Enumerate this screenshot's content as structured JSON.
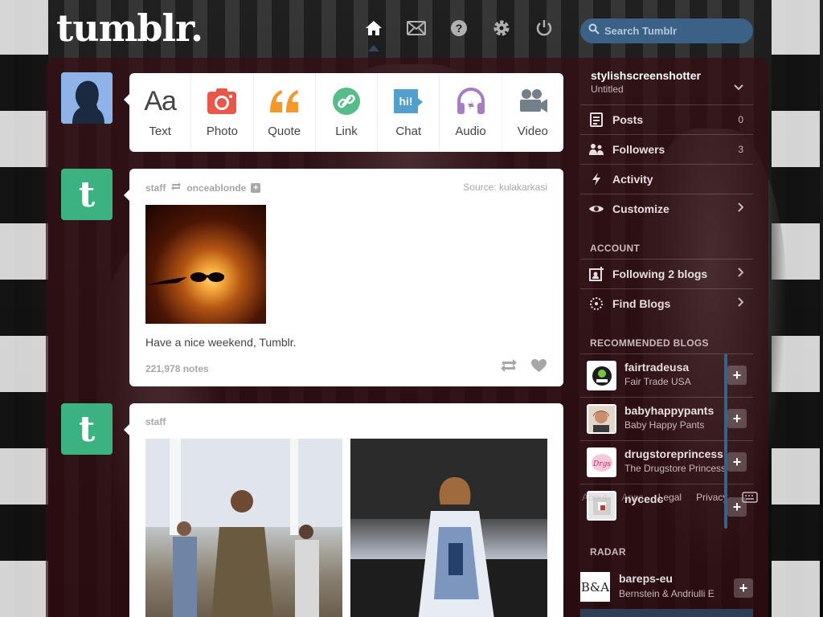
{
  "header": {
    "logo": "tumblr.",
    "nav": [
      {
        "icon": "home-icon",
        "active": true
      },
      {
        "icon": "mail-icon",
        "active": false
      },
      {
        "icon": "help-icon",
        "active": false
      },
      {
        "icon": "gear-icon",
        "active": false
      },
      {
        "icon": "power-icon",
        "active": false
      }
    ],
    "search_placeholder": "Search Tumblr"
  },
  "post_types": [
    {
      "label": "Text",
      "icon": "text-icon",
      "color": "#444444"
    },
    {
      "label": "Photo",
      "icon": "camera-icon",
      "color": "#e8574a"
    },
    {
      "label": "Quote",
      "icon": "quote-icon",
      "color": "#f2992e"
    },
    {
      "label": "Link",
      "icon": "link-icon",
      "color": "#56bc8a"
    },
    {
      "label": "Chat",
      "icon": "chat-icon",
      "color": "#529ecc"
    },
    {
      "label": "Audio",
      "icon": "headphones-icon",
      "color": "#a77dc2"
    },
    {
      "label": "Video",
      "icon": "video-camera-icon",
      "color": "#748089"
    }
  ],
  "posts": [
    {
      "author": "staff",
      "reblogged_from": "onceablonde",
      "source_label": "Source:",
      "source": "kulakarkasi",
      "caption": "Have a nice weekend, Tumblr.",
      "notes": "221,978 notes"
    },
    {
      "author": "staff"
    }
  ],
  "sidebar": {
    "blog_name": "stylishscreenshotter",
    "blog_title": "Untitled",
    "items": [
      {
        "label": "Posts",
        "icon": "posts-icon",
        "count": "0"
      },
      {
        "label": "Followers",
        "icon": "followers-icon",
        "count": "3"
      },
      {
        "label": "Activity",
        "icon": "activity-icon",
        "count": ""
      },
      {
        "label": "Customize",
        "icon": "eye-icon",
        "count": ""
      }
    ],
    "account_heading": "ACCOUNT",
    "account_items": [
      {
        "label": "Following 2 blogs",
        "icon": "following-icon"
      },
      {
        "label": "Find Blogs",
        "icon": "find-blogs-icon"
      }
    ],
    "recommended_heading": "RECOMMENDED BLOGS",
    "recommended": [
      {
        "name": "fairtradeusa",
        "desc": "Fair Trade USA",
        "thumb_color": "#ffffff"
      },
      {
        "name": "babyhappypants",
        "desc": "Baby Happy Pants",
        "thumb_color": "#c9a48a"
      },
      {
        "name": "drugstoreprincess",
        "desc": "The Drugstore Princess",
        "thumb_color": "#f4c9d9"
      },
      {
        "name": "nycedc",
        "desc": "",
        "thumb_color": "#e6e6e6"
      }
    ],
    "footer_links": [
      "About",
      "Apps",
      "Legal",
      "Privacy"
    ],
    "radar_heading": "RADAR",
    "radar": {
      "name": "bareps-eu",
      "desc": "Bernstein & Andriulli E",
      "thumb": "B&A"
    }
  },
  "colors": {
    "panel": "#340e14",
    "accent": "#3b6187",
    "tumblr_green": "#3bb27f"
  }
}
